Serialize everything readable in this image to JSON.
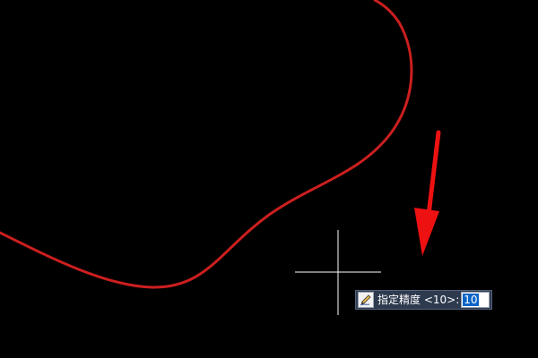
{
  "canvas": {
    "background_color": "#000000",
    "curve_color": "#cc1f1f",
    "arrow_color": "#ee1111",
    "crosshair_color": "#ffffff"
  },
  "dynamic_input": {
    "icon": "pencil-icon",
    "prompt_label": "指定精度 <10>:",
    "value": "10",
    "panel_color": "#2e3a4e",
    "highlight_color": "#0a64c8"
  }
}
